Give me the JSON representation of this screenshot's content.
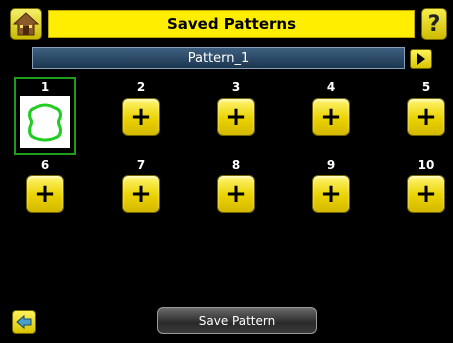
{
  "header": {
    "title": "Saved Patterns",
    "home_icon": "home-icon",
    "help_label": "?",
    "help_icon": "help-icon"
  },
  "pattern": {
    "name": "Pattern_1",
    "next_icon": "arrow-right-icon"
  },
  "slots": [
    {
      "number": "1",
      "state": "saved",
      "selected": true
    },
    {
      "number": "2",
      "state": "empty",
      "label": "+"
    },
    {
      "number": "3",
      "state": "empty",
      "label": "+"
    },
    {
      "number": "4",
      "state": "empty",
      "label": "+"
    },
    {
      "number": "5",
      "state": "empty",
      "label": "+"
    },
    {
      "number": "6",
      "state": "empty",
      "label": "+"
    },
    {
      "number": "7",
      "state": "empty",
      "label": "+"
    },
    {
      "number": "8",
      "state": "empty",
      "label": "+"
    },
    {
      "number": "9",
      "state": "empty",
      "label": "+"
    },
    {
      "number": "10",
      "state": "empty",
      "label": "+"
    }
  ],
  "footer": {
    "back_icon": "back-arrow-icon",
    "save_label": "Save Pattern"
  },
  "colors": {
    "title_bar": "#ffee00",
    "pattern_bar": "#2a4a68",
    "selection_border": "#1e9c1e",
    "pattern_outline": "#22cc22",
    "button_yellow": "#f0d800"
  }
}
